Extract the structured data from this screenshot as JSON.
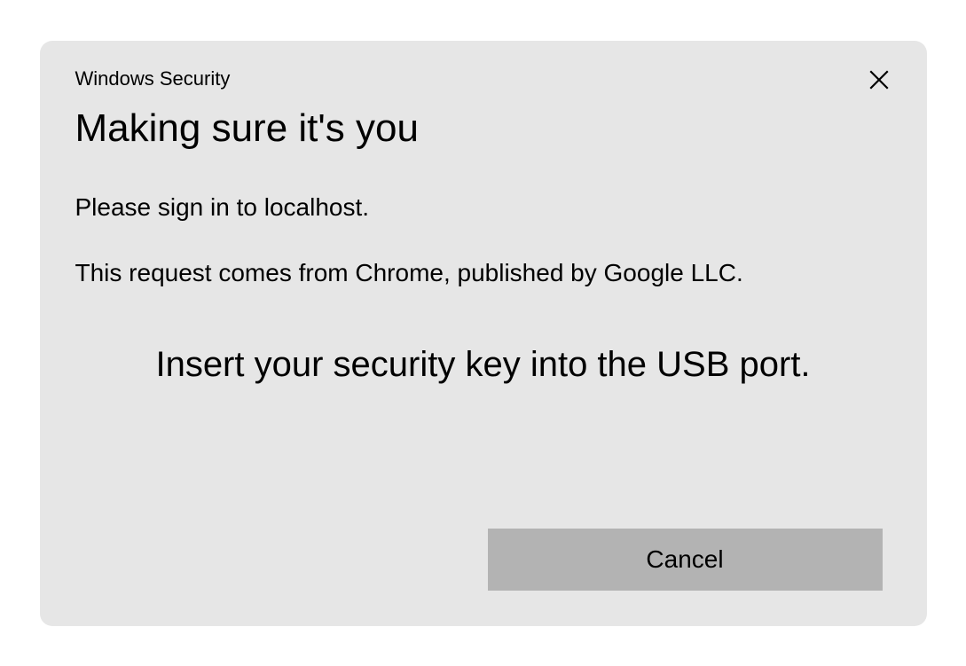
{
  "dialog": {
    "header_small": "Windows Security",
    "title": "Making sure it's you",
    "body_line1": "Please sign in to localhost.",
    "body_line2": "This request comes from Chrome, published by Google LLC.",
    "instruction": "Insert your security key into the USB port.",
    "cancel_label": "Cancel"
  }
}
